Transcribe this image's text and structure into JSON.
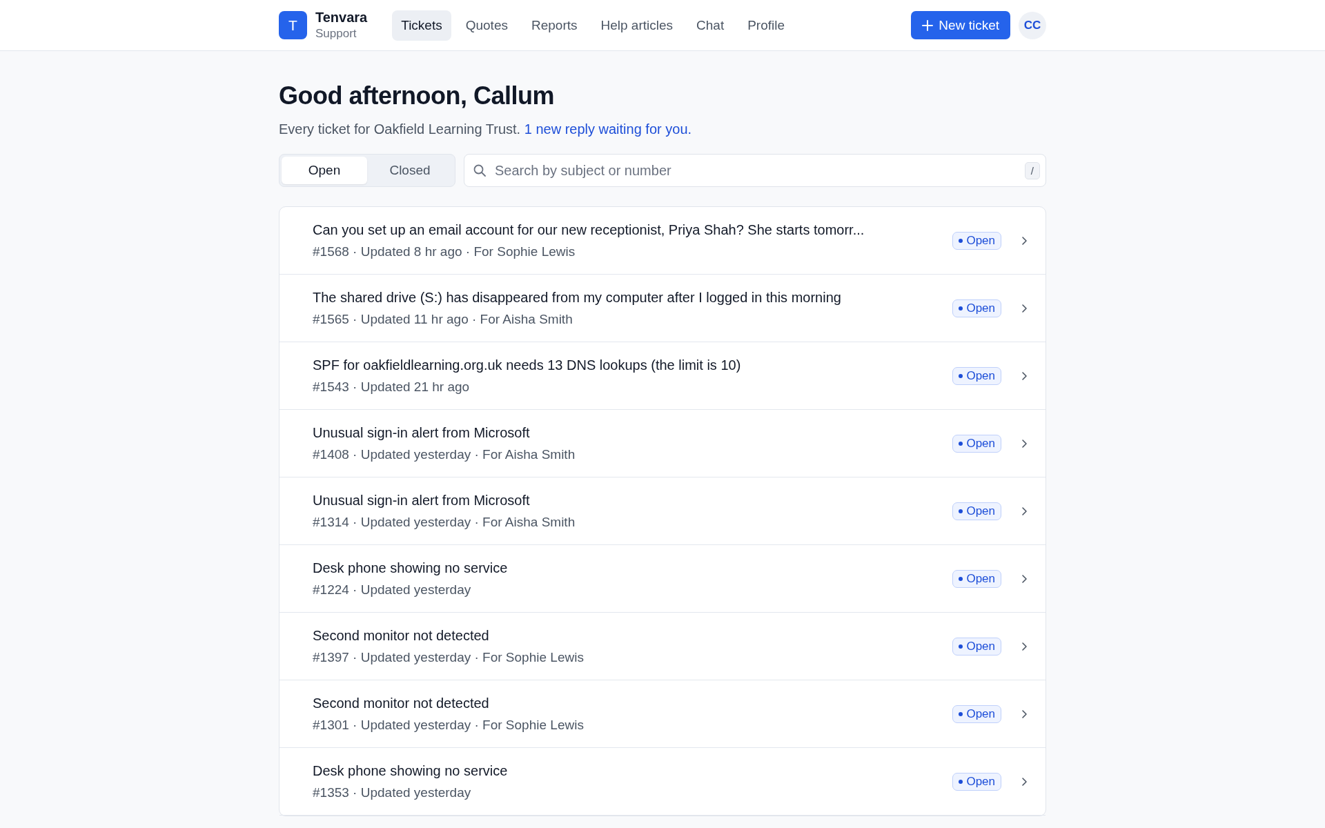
{
  "brand": {
    "logo": "T",
    "name": "Tenvara",
    "subtitle": "Support"
  },
  "nav": [
    {
      "label": "Tickets",
      "selected": true
    },
    {
      "label": "Quotes",
      "selected": false
    },
    {
      "label": "Reports",
      "selected": false
    },
    {
      "label": "Help articles",
      "selected": false
    },
    {
      "label": "Chat",
      "selected": false
    },
    {
      "label": "Profile",
      "selected": false
    }
  ],
  "new_ticket_button": "New ticket",
  "avatar": "CC",
  "greeting": "Good afternoon, Callum",
  "intro": "Every ticket for Oakfield Learning Trust.",
  "intro_link": "1 new reply waiting for you.",
  "filter_tabs": [
    {
      "label": "Open",
      "selected": true
    },
    {
      "label": "Closed",
      "selected": false
    }
  ],
  "search": {
    "placeholder": "Search by subject or number",
    "shortcut": "/"
  },
  "tickets": [
    {
      "subject": "Can you set up an email account for our new receptionist, Priya Shah? She starts tomorr...",
      "meta": "#1568 · Updated 8 hr ago · For Sophie Lewis",
      "status": "Open"
    },
    {
      "subject": "The shared drive (S:) has disappeared from my computer after I logged in this morning",
      "meta": "#1565 · Updated 11 hr ago · For Aisha Smith",
      "status": "Open"
    },
    {
      "subject": "SPF for oakfieldlearning.org.uk needs 13 DNS lookups (the limit is 10)",
      "meta": "#1543 · Updated 21 hr ago",
      "status": "Open"
    },
    {
      "subject": "Unusual sign-in alert from Microsoft",
      "meta": "#1408 · Updated yesterday · For Aisha Smith",
      "status": "Open"
    },
    {
      "subject": "Unusual sign-in alert from Microsoft",
      "meta": "#1314 · Updated yesterday · For Aisha Smith",
      "status": "Open"
    },
    {
      "subject": "Desk phone showing no service",
      "meta": "#1224 · Updated yesterday",
      "status": "Open"
    },
    {
      "subject": "Second monitor not detected",
      "meta": "#1397 · Updated yesterday · For Sophie Lewis",
      "status": "Open"
    },
    {
      "subject": "Second monitor not detected",
      "meta": "#1301 · Updated yesterday · For Sophie Lewis",
      "status": "Open"
    },
    {
      "subject": "Desk phone showing no service",
      "meta": "#1353 · Updated yesterday",
      "status": "Open"
    }
  ]
}
